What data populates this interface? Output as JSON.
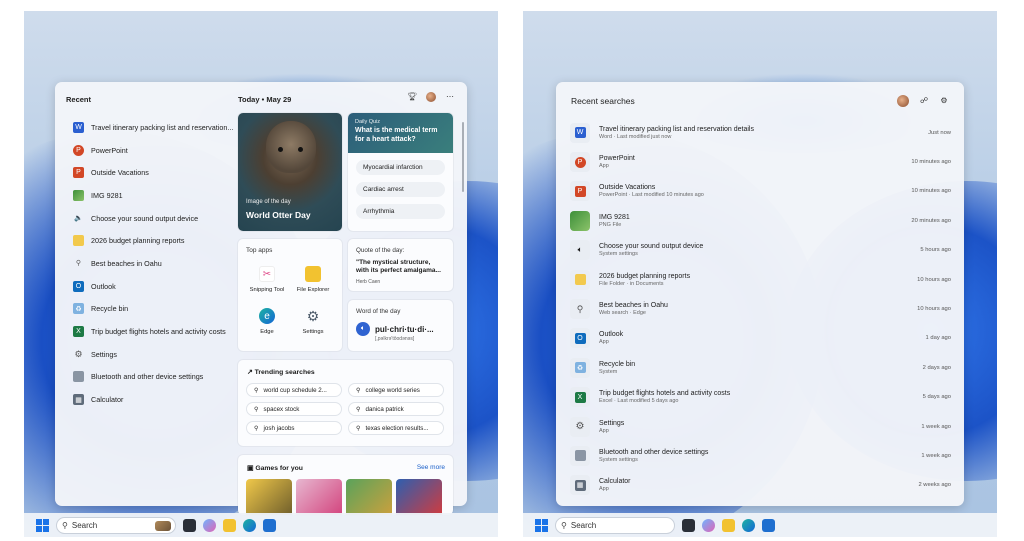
{
  "left": {
    "recent": {
      "heading": "Recent",
      "items": [
        {
          "label": "Travel itinerary packing list and reservation...",
          "icon": "word-doc-icon"
        },
        {
          "label": "PowerPoint",
          "icon": "powerpoint-icon"
        },
        {
          "label": "Outside Vacations",
          "icon": "powerpoint-file-icon"
        },
        {
          "label": "IMG 9281",
          "icon": "image-icon"
        },
        {
          "label": "Choose your sound output device",
          "icon": "speaker-icon"
        },
        {
          "label": "2026 budget planning reports",
          "icon": "folder-icon"
        },
        {
          "label": "Best beaches in Oahu",
          "icon": "search-icon"
        },
        {
          "label": "Outlook",
          "icon": "outlook-icon"
        },
        {
          "label": "Recycle bin",
          "icon": "recycle-bin-icon"
        },
        {
          "label": "Trip budget flights hotels and activity costs",
          "icon": "excel-file-icon"
        },
        {
          "label": "Settings",
          "icon": "gear-icon"
        },
        {
          "label": "Bluetooth and other device settings",
          "icon": "device-settings-icon"
        },
        {
          "label": "Calculator",
          "icon": "calculator-icon"
        }
      ]
    },
    "today": "Today • May 29",
    "image_of_day": {
      "label": "Image of the day",
      "title": "World Otter Day"
    },
    "quiz": {
      "label": "Daily Quiz",
      "question": "What is the medical term for a heart attack?",
      "options": [
        "Myocardial infarction",
        "Cardiac arrest",
        "Arrhythmia"
      ]
    },
    "top_apps": {
      "heading": "Top apps",
      "apps": [
        "Snipping Tool",
        "File Explorer",
        "Edge",
        "Settings"
      ]
    },
    "quote": {
      "heading": "Quote of the day:",
      "text": "\"The mystical structure, with its perfect amalgama...",
      "author": "Herb Caen"
    },
    "word": {
      "heading": "Word of the day",
      "word": "pul·chri·tu·di·...",
      "pron": "[,pəlkrə'tōodənəs]"
    },
    "trending": {
      "heading": "Trending searches",
      "items": [
        "world cup schedule 2...",
        "college world series",
        "spacex stock",
        "danica patrick",
        "josh jacobs",
        "texas election results..."
      ]
    },
    "games": {
      "heading": "Games for you",
      "see_more": "See more"
    },
    "taskbar_search": "Search"
  },
  "right": {
    "heading": "Recent searches",
    "items": [
      {
        "title": "Travel itinerary packing list and reservation details",
        "sub": "Word · Last modified just now",
        "time": "Just now"
      },
      {
        "title": "PowerPoint",
        "sub": "App",
        "time": "10 minutes ago"
      },
      {
        "title": "Outside Vacations",
        "sub": "PowerPoint · Last modified 10 minutes ago",
        "time": "10 minutes ago"
      },
      {
        "title": "IMG 9281",
        "sub": "PNG File",
        "time": "20 minutes ago"
      },
      {
        "title": "Choose your sound output device",
        "sub": "System settings",
        "time": "5 hours ago"
      },
      {
        "title": "2026 budget planning reports",
        "sub": "File Folder · in Documents",
        "time": "10 hours ago"
      },
      {
        "title": "Best beaches in Oahu",
        "sub": "Web search · Edge",
        "time": "10 hours ago"
      },
      {
        "title": "Outlook",
        "sub": "App",
        "time": "1 day ago"
      },
      {
        "title": "Recycle bin",
        "sub": "System",
        "time": "2 days ago"
      },
      {
        "title": "Trip budget flights hotels and activity costs",
        "sub": "Excel · Last modified 5 days ago",
        "time": "5 days ago"
      },
      {
        "title": "Settings",
        "sub": "App",
        "time": "1 week ago"
      },
      {
        "title": "Bluetooth and other device settings",
        "sub": "System settings",
        "time": "1 week ago"
      },
      {
        "title": "Calculator",
        "sub": "App",
        "time": "2 weeks ago"
      }
    ],
    "taskbar_search": "Search"
  }
}
